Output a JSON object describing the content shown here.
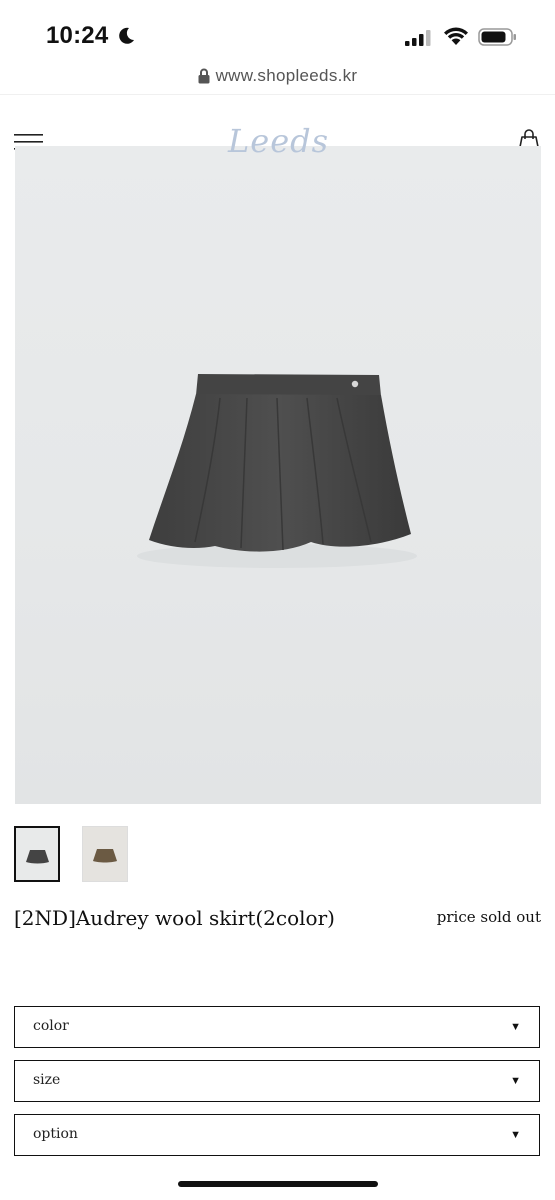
{
  "status_bar": {
    "time": "10:24",
    "icons": [
      "moon-icon",
      "cellular-signal-icon",
      "wifi-icon",
      "battery-icon"
    ]
  },
  "browser": {
    "url": "www.shopleeds.kr",
    "icons": [
      "lock-icon"
    ]
  },
  "header": {
    "logo": "Leeds",
    "logo_color": "#b8c6da",
    "icons": [
      "menu-icon",
      "shopping-bag-icon",
      "heart-icon"
    ]
  },
  "product": {
    "title": "[2ND]Audrey wool skirt(2color)",
    "price_text": "price sold out",
    "thumbnails": [
      "thumbnail-grey-skirt",
      "thumbnail-brown-skirt"
    ],
    "selected_thumbnail": 0
  },
  "options": {
    "color": {
      "label": "color",
      "arrow": "▼"
    },
    "size": {
      "label": "size",
      "arrow": "▼"
    },
    "option": {
      "label": "option",
      "arrow": "▼"
    }
  },
  "colors": {
    "skirt_grey": "#4a4a4a",
    "skirt_brown": "#6b5a43",
    "background": "#e8eaeb"
  }
}
